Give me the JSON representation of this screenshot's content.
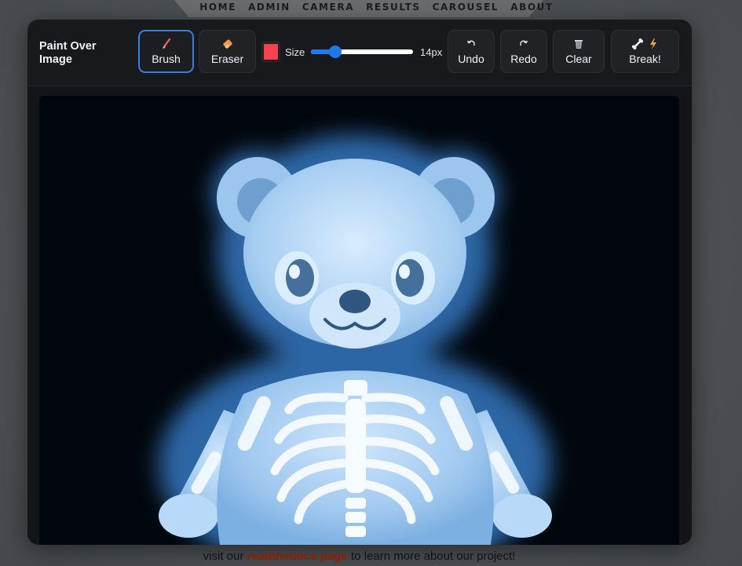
{
  "nav": {
    "items": [
      "HOME",
      "ADMIN",
      "CAMERA",
      "RESULTS",
      "CAROUSEL",
      "ABOUT"
    ]
  },
  "editor": {
    "title": "Paint Over\nImage",
    "tools": {
      "brush": {
        "label": "Brush",
        "icon": "paintbrush-icon",
        "active": true
      },
      "eraser": {
        "label": "Eraser",
        "icon": "eraser-icon",
        "active": false
      }
    },
    "brush_color": "#f0454f",
    "size_label": "Size",
    "size_value": "14px",
    "size_fraction": 0.24,
    "actions": {
      "undo": {
        "label": "Undo",
        "icon": "undo-icon"
      },
      "redo": {
        "label": "Redo",
        "icon": "redo-icon"
      },
      "clear": {
        "label": "Clear",
        "icon": "trash-icon"
      },
      "break": {
        "label": "Break!",
        "icons": [
          "bone-icon",
          "lightning-icon"
        ]
      }
    },
    "image": {
      "subject": "glowing x-ray teddy bear with skeleton ribcage"
    }
  },
  "footer": {
    "prefix": "visit our ",
    "link_text": "readthedocs page",
    "suffix": " to learn more about our project!"
  },
  "colors": {
    "accent": "#3d7fe0",
    "slider": "#1f7ae8",
    "link": "#8a1f06"
  }
}
